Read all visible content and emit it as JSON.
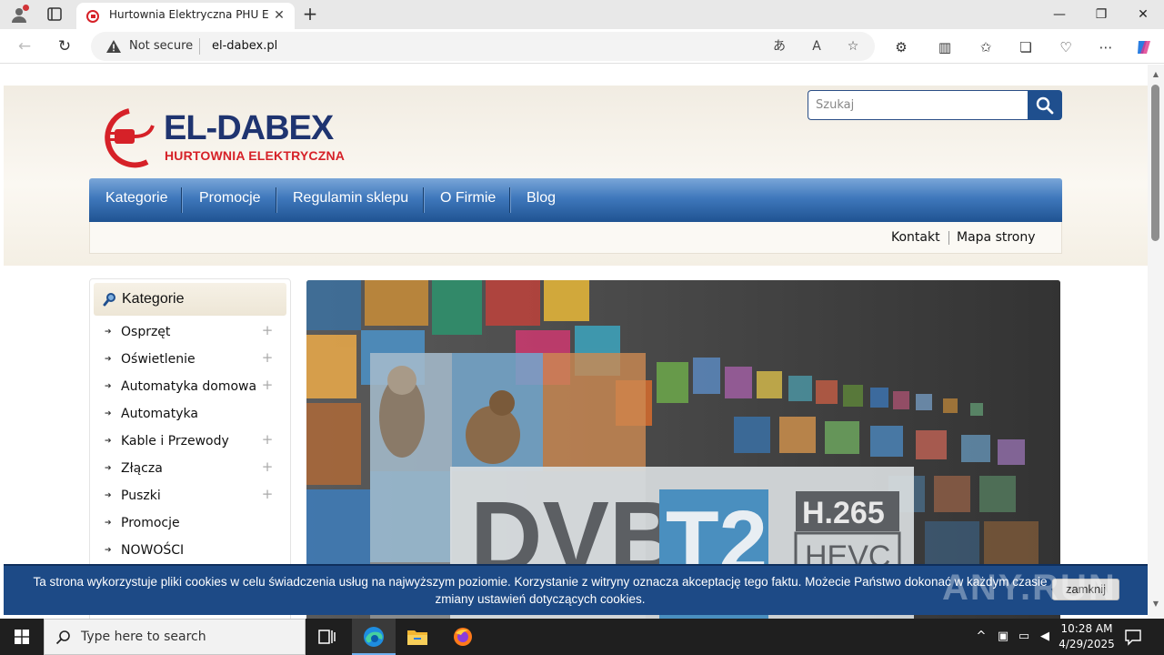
{
  "browser": {
    "tab_title": "Hurtownia Elektryczna PHU EL-DABEX",
    "tab_close": "✕",
    "new_tab": "+",
    "not_secure": "Not secure",
    "url": "el-dabex.pl",
    "window": {
      "minimize": "—",
      "restore": "❐",
      "close": "✕"
    }
  },
  "site": {
    "logo_title": "EL-DABEX",
    "logo_subtitle": "HURTOWNIA ELEKTRYCZNA",
    "search_placeholder": "Szukaj",
    "nav": [
      "Kategorie",
      "Promocje",
      "Regulamin sklepu",
      "O Firmie",
      "Blog"
    ],
    "subnav": [
      "Kontakt",
      "Mapa strony"
    ],
    "sidebar": {
      "title": "Kategorie",
      "items": [
        {
          "label": "Osprzęt",
          "expandable": true
        },
        {
          "label": "Oświetlenie",
          "expandable": true
        },
        {
          "label": "Automatyka domowa",
          "expandable": true
        },
        {
          "label": "Automatyka",
          "expandable": false
        },
        {
          "label": "Kable i Przewody",
          "expandable": true
        },
        {
          "label": "Złącza",
          "expandable": true
        },
        {
          "label": "Puszki",
          "expandable": true
        },
        {
          "label": "Promocje",
          "expandable": false
        },
        {
          "label": "NOWOŚCI",
          "expandable": false
        }
      ]
    },
    "banner": {
      "logo_main": "DVB",
      "logo_t2": "T2",
      "codec_top": "H.265",
      "codec_bottom": "HEVC"
    },
    "cookie": {
      "text": "Ta strona wykorzystuje pliki cookies w celu świadczenia usług na najwyższym poziomie. Korzystanie z witryny oznacza akceptację tego faktu. Możecie Państwo dokonać w każdym czasie zmiany ustawień dotyczących cookies.",
      "button": "zamknij"
    },
    "watermark": "ANY.RUN"
  },
  "taskbar": {
    "search_placeholder": "Type here to search",
    "time": "10:28 AM",
    "date": "4/29/2025"
  },
  "colors": {
    "brand_blue": "#1f3470",
    "brand_red": "#d62128",
    "nav_blue": "#3f78bc",
    "cookie_bg": "#1d4a86"
  }
}
